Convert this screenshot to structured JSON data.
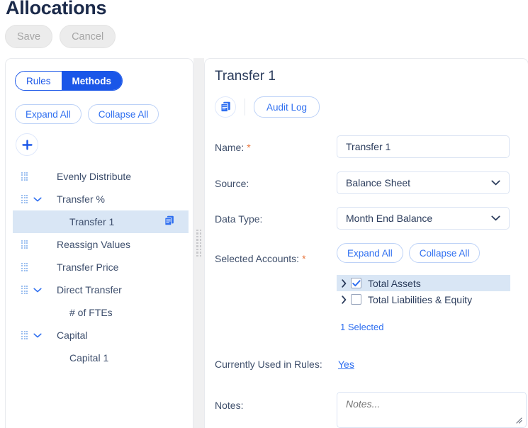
{
  "header": {
    "title": "Allocations",
    "save_label": "Save",
    "cancel_label": "Cancel"
  },
  "left_panel": {
    "segmented": {
      "rules_label": "Rules",
      "methods_label": "Methods",
      "active": "Methods"
    },
    "expand_all_label": "Expand All",
    "collapse_all_label": "Collapse All",
    "add_icon": "plus-icon",
    "tree": [
      {
        "label": "Evenly Distribute",
        "level": 0,
        "grip": true,
        "chevron": "none",
        "selected": false,
        "copy_icon": false
      },
      {
        "label": "Transfer %",
        "level": 0,
        "grip": true,
        "chevron": "down",
        "selected": false,
        "copy_icon": false
      },
      {
        "label": "Transfer 1",
        "level": 1,
        "grip": false,
        "chevron": "none",
        "selected": true,
        "copy_icon": true
      },
      {
        "label": "Reassign Values",
        "level": 0,
        "grip": true,
        "chevron": "none",
        "selected": false,
        "copy_icon": false
      },
      {
        "label": "Transfer Price",
        "level": 0,
        "grip": true,
        "chevron": "none",
        "selected": false,
        "copy_icon": false
      },
      {
        "label": "Direct Transfer",
        "level": 0,
        "grip": true,
        "chevron": "down",
        "selected": false,
        "copy_icon": false
      },
      {
        "label": "# of FTEs",
        "level": 1,
        "grip": false,
        "chevron": "none",
        "selected": false,
        "copy_icon": false
      },
      {
        "label": "Capital",
        "level": 0,
        "grip": true,
        "chevron": "down",
        "selected": false,
        "copy_icon": false
      },
      {
        "label": "Capital 1",
        "level": 1,
        "grip": false,
        "chevron": "none",
        "selected": false,
        "copy_icon": false
      }
    ]
  },
  "right_panel": {
    "title": "Transfer 1",
    "copy_icon": "copy-icon",
    "audit_log_label": "Audit Log",
    "fields": {
      "name_label": "Name:",
      "name_value": "Transfer 1",
      "source_label": "Source:",
      "source_value": "Balance Sheet",
      "data_type_label": "Data Type:",
      "data_type_value": "Month End Balance",
      "selected_accounts_label": "Selected Accounts:",
      "used_in_rules_label": "Currently Used in Rules:",
      "used_in_rules_value": "Yes",
      "notes_label": "Notes:",
      "notes_value": "",
      "notes_placeholder": "Notes..."
    },
    "accounts_expand_all_label": "Expand All",
    "accounts_collapse_all_label": "Collapse All",
    "accounts": [
      {
        "label": "Total Assets",
        "checked": true,
        "selected": true
      },
      {
        "label": "Total Liabilities & Equity",
        "checked": false,
        "selected": false
      }
    ],
    "selected_count_label": "1 Selected"
  },
  "colors": {
    "accent_blue": "#1a56e8",
    "link_blue": "#2f6ff0",
    "selected_row": "#d9e6f5",
    "required_asterisk": "#e8743b",
    "text_navy": "#2b3c5c"
  }
}
